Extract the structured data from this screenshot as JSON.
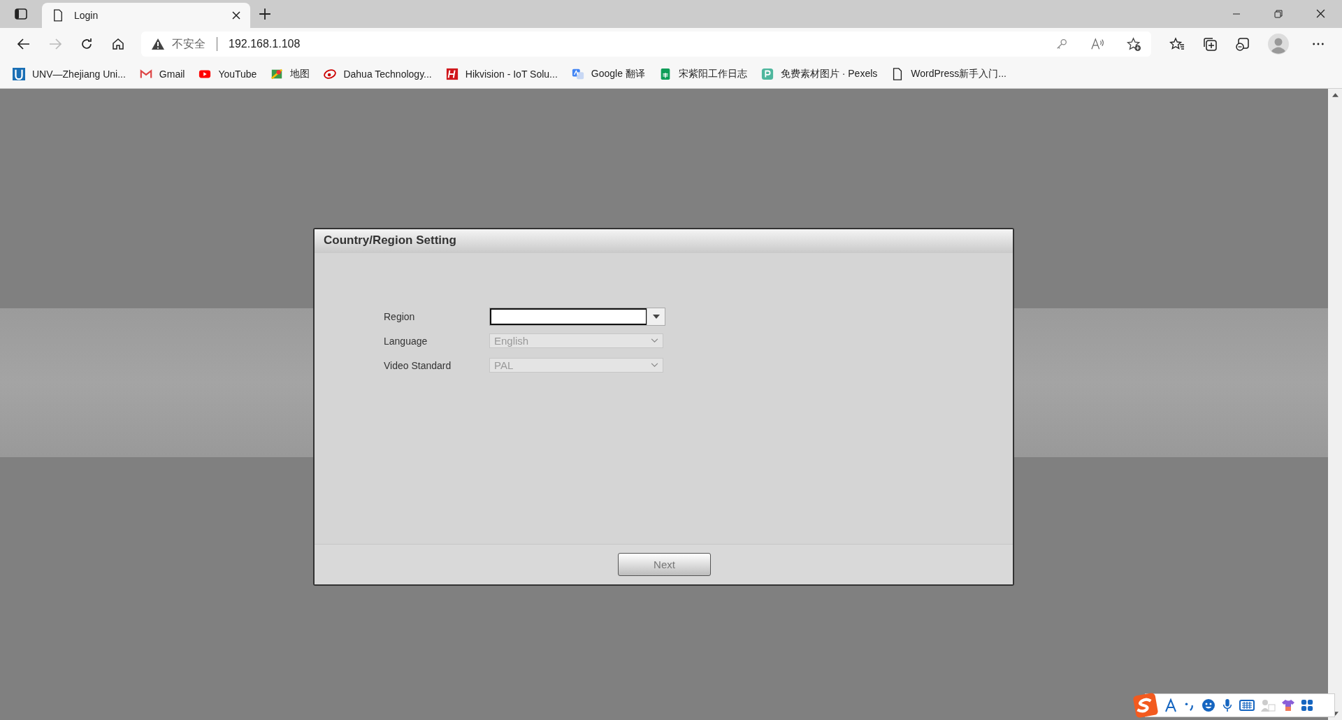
{
  "browser": {
    "tabs": [
      {
        "title": "Login",
        "selected": true
      }
    ],
    "address": {
      "security": "不安全",
      "url": "192.168.1.108"
    },
    "bookmarks": [
      {
        "label": "UNV—Zhejiang Uni...",
        "kind": "unv"
      },
      {
        "label": "Gmail",
        "kind": "gmail"
      },
      {
        "label": "YouTube",
        "kind": "youtube"
      },
      {
        "label": "地图",
        "kind": "maps"
      },
      {
        "label": "Dahua Technology...",
        "kind": "dahua"
      },
      {
        "label": "Hikvision - IoT Solu...",
        "kind": "hikvision"
      },
      {
        "label": "Google 翻译",
        "kind": "translate"
      },
      {
        "label": "宋紫阳工作日志",
        "kind": "sheets"
      },
      {
        "label": "免费素材图片 · Pexels",
        "kind": "pexels"
      },
      {
        "label": "WordPress新手入门...",
        "kind": "page"
      }
    ]
  },
  "dialog": {
    "title": "Country/Region Setting",
    "fields": [
      {
        "label": "Region",
        "disabled": false
      },
      {
        "label": "Language",
        "value": "English",
        "disabled": true
      },
      {
        "label": "Video Standard",
        "value": "PAL",
        "disabled": true
      }
    ],
    "next_button": {
      "label": "Next",
      "disabled": true
    }
  }
}
